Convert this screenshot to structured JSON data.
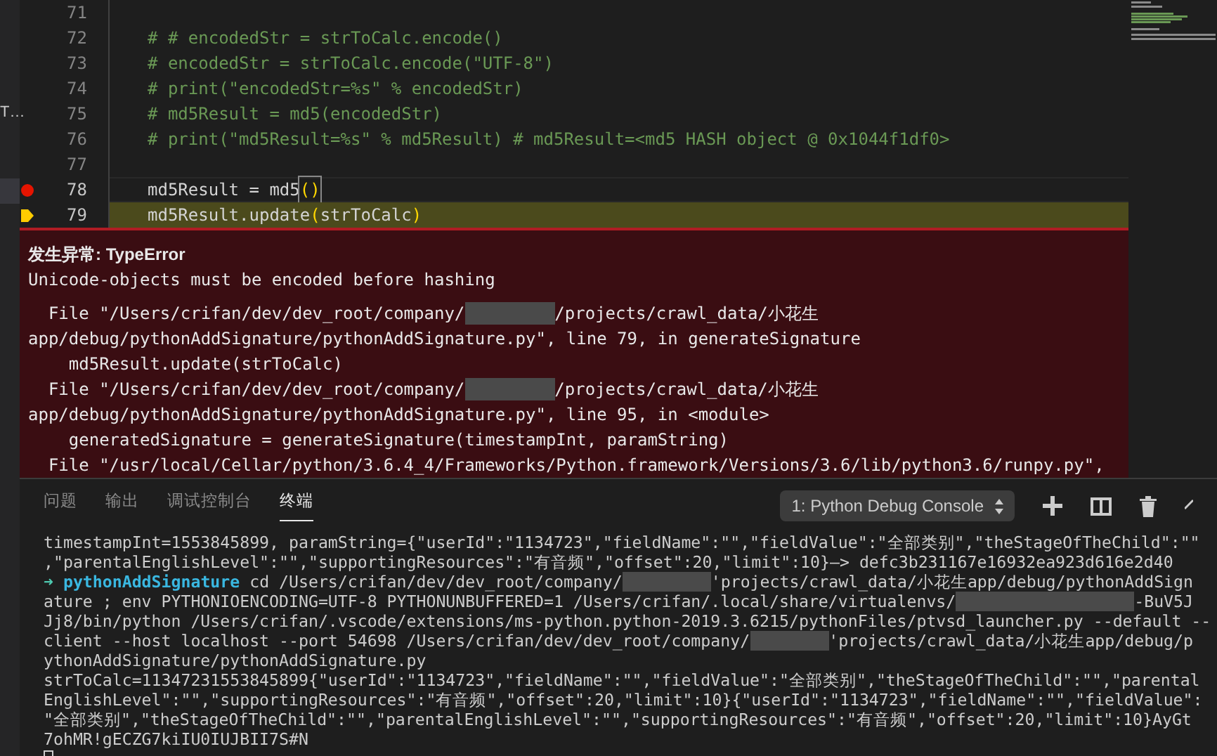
{
  "sidebar": {
    "items": [
      {
        "label": "T…",
        "selected": false
      },
      {
        "selected": true
      }
    ]
  },
  "editor": {
    "lines": [
      {
        "number": "71",
        "breakpoint": false,
        "paused": false
      },
      {
        "number": "72",
        "breakpoint": false,
        "paused": false,
        "tokens": [
          {
            "kind": "comment",
            "text": "# # encodedStr = strToCalc.encode()"
          }
        ]
      },
      {
        "number": "73",
        "breakpoint": false,
        "paused": false,
        "tokens": [
          {
            "kind": "comment",
            "text": "# encodedStr = strToCalc.encode(\"UTF-8\")"
          }
        ]
      },
      {
        "number": "74",
        "breakpoint": false,
        "paused": false,
        "tokens": [
          {
            "kind": "comment",
            "text": "# print(\"encodedStr=%s\" % encodedStr)"
          }
        ]
      },
      {
        "number": "75",
        "breakpoint": false,
        "paused": false,
        "tokens": [
          {
            "kind": "comment",
            "text": "# md5Result = md5(encodedStr)"
          }
        ]
      },
      {
        "number": "76",
        "breakpoint": false,
        "paused": false,
        "tokens": [
          {
            "kind": "comment",
            "text": "# print(\"md5Result=%s\" % md5Result) # md5Result=<md5 HASH object @ 0x1044f1df0>"
          }
        ]
      },
      {
        "number": "77",
        "breakpoint": false,
        "paused": false
      },
      {
        "number": "78",
        "breakpoint": true,
        "paused": false,
        "tokens": [
          {
            "kind": "plain",
            "text": "md5Result = md5"
          },
          {
            "kind": "bracket",
            "text": "()"
          }
        ]
      },
      {
        "number": "79",
        "breakpoint": false,
        "paused": true,
        "tokens": [
          {
            "kind": "plain",
            "text": "md5Result.update"
          },
          {
            "kind": "bracket",
            "text": "("
          },
          {
            "kind": "plain",
            "text": "strToCalc"
          },
          {
            "kind": "bracket",
            "text": ")"
          }
        ]
      }
    ]
  },
  "exception": {
    "title": "发生异常: TypeError",
    "message": "Unicode-objects must be encoded before hashing",
    "trace": [
      [
        {
          "kind": "text",
          "text": "  File \"/Users/crifan/dev/dev_root/company/"
        },
        {
          "kind": "redacted"
        },
        {
          "kind": "text",
          "text": "/projects/crawl_data/小花生"
        }
      ],
      [
        {
          "kind": "text",
          "text": "app/debug/pythonAddSignature/pythonAddSignature.py\", line 79, in generateSignature"
        }
      ],
      [
        {
          "kind": "text",
          "text": "    md5Result.update(strToCalc)"
        }
      ],
      [
        {
          "kind": "text",
          "text": "  File \"/Users/crifan/dev/dev_root/company/"
        },
        {
          "kind": "redacted"
        },
        {
          "kind": "text",
          "text": "/projects/crawl_data/小花生"
        }
      ],
      [
        {
          "kind": "text",
          "text": "app/debug/pythonAddSignature/pythonAddSignature.py\", line 95, in <module>"
        }
      ],
      [
        {
          "kind": "text",
          "text": "    generatedSignature = generateSignature(timestampInt, paramString)"
        }
      ],
      [
        {
          "kind": "text",
          "text": "  File \"/usr/local/Cellar/python/3.6.4_4/Frameworks/Python.framework/Versions/3.6/lib/python3.6/runpy.py\","
        }
      ]
    ]
  },
  "panel": {
    "tabs": [
      {
        "label": "问题",
        "selected": false
      },
      {
        "label": "输出",
        "selected": false
      },
      {
        "label": "调试控制台",
        "selected": false
      },
      {
        "label": "终端",
        "selected": true
      }
    ],
    "terminal_select": "1: Python Debug Console",
    "terminal": [
      [
        {
          "kind": "text",
          "text": "timestampInt=1553845899, paramString={\"userId\":\"1134723\",\"fieldName\":\"\",\"fieldValue\":\"全部类别\",\"theStageOfTheChild\":\"\""
        }
      ],
      [
        {
          "kind": "text",
          "text": ",\"parentalEnglishLevel\":\"\",\"supportingResources\":\"有音频\",\"offset\":20,\"limit\":10}—> defc3b231167e16932ea923d616e2d40"
        }
      ],
      [
        {
          "kind": "prompt",
          "text": "➜ "
        },
        {
          "kind": "dir",
          "text": "pythonAddSignature"
        },
        {
          "kind": "text",
          "text": " cd /Users/crifan/dev/dev_root/company/"
        },
        {
          "kind": "redacted"
        },
        {
          "kind": "text",
          "text": "'projects/crawl_data/小花生app/debug/pythonAddSign"
        }
      ],
      [
        {
          "kind": "text",
          "text": "ature ; env PYTHONIOENCODING=UTF-8 PYTHONUNBUFFERED=1 /Users/crifan/.local/share/virtualenvs/"
        },
        {
          "kind": "redacted"
        },
        {
          "kind": "text",
          "text": "-BuV5J"
        }
      ],
      [
        {
          "kind": "text",
          "text": "Jj8/bin/python /Users/crifan/.vscode/extensions/ms-python.python-2019.3.6215/pythonFiles/ptvsd_launcher.py --default --"
        }
      ],
      [
        {
          "kind": "text",
          "text": "client --host localhost --port 54698 /Users/crifan/dev/dev_root/company/"
        },
        {
          "kind": "redacted"
        },
        {
          "kind": "text",
          "text": "'projects/crawl_data/小花生app/debug/p"
        }
      ],
      [
        {
          "kind": "text",
          "text": "ythonAddSignature/pythonAddSignature.py"
        }
      ],
      [
        {
          "kind": "text",
          "text": "strToCalc=11347231553845899{\"userId\":\"1134723\",\"fieldName\":\"\",\"fieldValue\":\"全部类别\",\"theStageOfTheChild\":\"\",\"parental"
        }
      ],
      [
        {
          "kind": "text",
          "text": "EnglishLevel\":\"\",\"supportingResources\":\"有音频\",\"offset\":20,\"limit\":10}{\"userId\":\"1134723\",\"fieldName\":\"\",\"fieldValue\":"
        }
      ],
      [
        {
          "kind": "text",
          "text": "\"全部类别\",\"theStageOfTheChild\":\"\",\"parentalEnglishLevel\":\"\",\"supportingResources\":\"有音频\",\"offset\":20,\"limit\":10}AyGt"
        }
      ],
      [
        {
          "kind": "text",
          "text": "7ohMR!gECZG7kiIU0IUJBII7S#N"
        }
      ],
      [
        {
          "kind": "cursor"
        }
      ]
    ]
  }
}
